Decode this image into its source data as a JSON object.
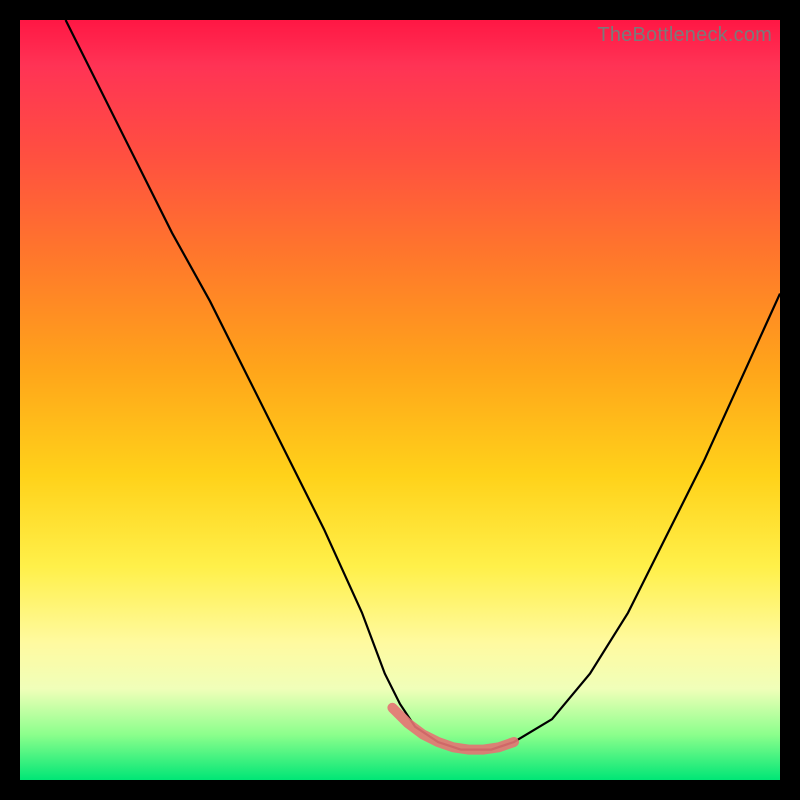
{
  "watermark": "TheBottleneck.com",
  "chart_data": {
    "type": "line",
    "title": "",
    "xlabel": "",
    "ylabel": "",
    "xlim": [
      0,
      100
    ],
    "ylim": [
      0,
      100
    ],
    "series": [
      {
        "name": "main-curve",
        "color": "#000000",
        "x": [
          6,
          10,
          15,
          20,
          25,
          30,
          35,
          40,
          45,
          48,
          50,
          52,
          55,
          58,
          60,
          62,
          65,
          70,
          75,
          80,
          85,
          90,
          95,
          100
        ],
        "y": [
          100,
          92,
          82,
          72,
          63,
          53,
          43,
          33,
          22,
          14,
          10,
          7,
          5,
          4,
          4,
          4,
          5,
          8,
          14,
          22,
          32,
          42,
          53,
          64
        ]
      },
      {
        "name": "trough-highlight",
        "color": "#e57373",
        "x": [
          49,
          51,
          53,
          55,
          57,
          59,
          61,
          63,
          65
        ],
        "y": [
          9.5,
          7.5,
          6,
          5,
          4.3,
          4,
          4,
          4.3,
          5
        ]
      }
    ]
  }
}
